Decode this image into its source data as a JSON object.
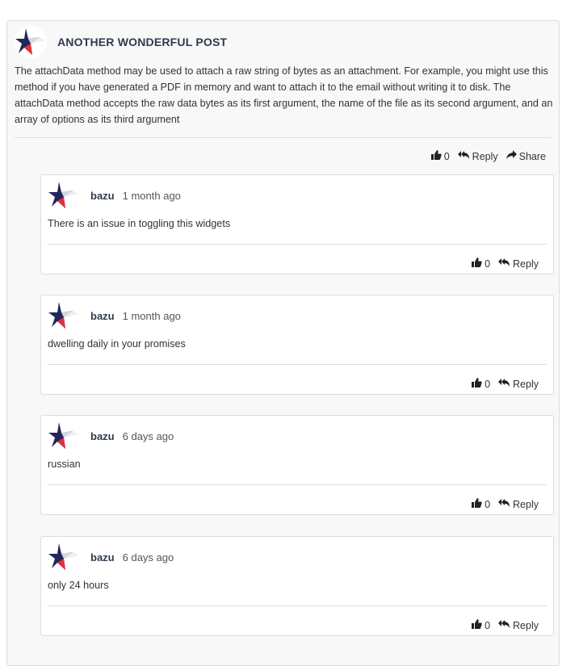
{
  "post": {
    "title": "ANOTHER WONDERFUL POST",
    "body": "The attachData method may be used to attach a raw string of bytes as an attachment. For example, you might use this method if you have generated a PDF in memory and want to attach it to the email without writing it to disk. The attachData method accepts the raw data bytes as its first argument, the name of the file as its second argument, and an array of options as its third argument",
    "likes": "0",
    "reply_label": "Reply",
    "share_label": "Share"
  },
  "comments": [
    {
      "author": "bazu",
      "time": "1 month ago",
      "text": "There is an issue in toggling this widgets",
      "likes": "0",
      "reply_label": "Reply"
    },
    {
      "author": "bazu",
      "time": "1 month ago",
      "text": "dwelling daily in your promises",
      "likes": "0",
      "reply_label": "Reply"
    },
    {
      "author": "bazu",
      "time": "6 days ago",
      "text": "russian",
      "likes": "0",
      "reply_label": "Reply"
    },
    {
      "author": "bazu",
      "time": "6 days ago",
      "text": "only 24 hours",
      "likes": "0",
      "reply_label": "Reply"
    }
  ],
  "colors": {
    "title": "#2f3a4f",
    "star_navy": "#22265a",
    "star_red": "#e0323c"
  },
  "icons": {
    "avatar": "star-logo-icon",
    "like": "thumbs-up-icon",
    "reply": "reply-all-icon",
    "share": "share-icon"
  }
}
